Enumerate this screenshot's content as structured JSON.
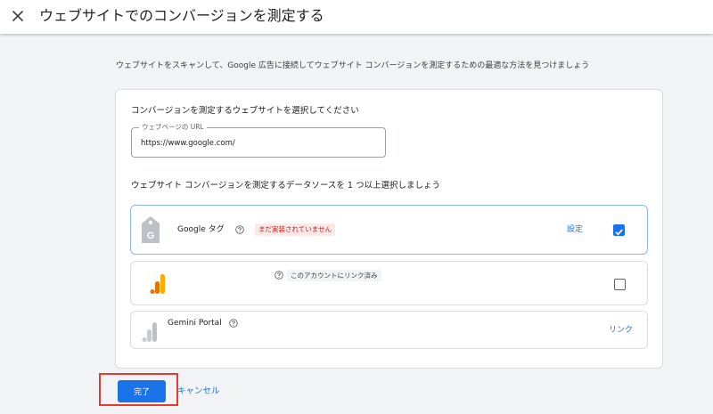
{
  "header": {
    "title": "ウェブサイトでのコンバージョンを測定する",
    "close_icon": "close-icon"
  },
  "intro_text": "ウェブサイトをスキャンして、Google 広告に接続してウェブサイト コンバージョンを測定するための最適な方法を見つけましょう",
  "website_section": {
    "title": "コンバージョンを測定するウェブサイトを選択してください",
    "url_field": {
      "label": "ウェブページの URL",
      "value": "https://www.google.com/"
    }
  },
  "sources_section": {
    "title": "ウェブサイト コンバージョンを測定するデータソースを 1 つ以上選択しましょう",
    "sources": [
      {
        "name": "Google タグ",
        "icon": "google-tag-icon",
        "status_badge": "まだ実装されていません",
        "action_label": "設定",
        "checked": true
      },
      {
        "name": "",
        "icon": "google-analytics-icon",
        "status_badge": "このアカウントにリンク済み",
        "checked": false
      },
      {
        "name": "Gemini Portal",
        "icon": "gemini-portal-icon",
        "action_label": "リンク"
      }
    ]
  },
  "footer": {
    "done_label": "完了",
    "cancel_label": "キャンセル"
  },
  "colors": {
    "accent": "#1a73e8",
    "error_text": "#c5221f",
    "error_bg": "#fce8e6",
    "highlight_box": "#e53935",
    "analytics_orange": "#f9ab00",
    "analytics_dark_orange": "#e37400"
  }
}
